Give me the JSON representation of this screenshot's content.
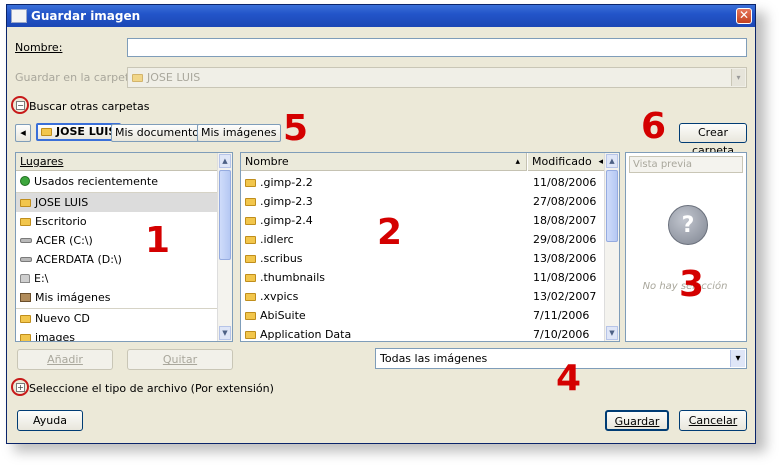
{
  "window": {
    "title": "Guardar imagen",
    "close_glyph": "✕"
  },
  "name_field": {
    "label": "Nombre:",
    "value": ""
  },
  "save_in": {
    "label": "Guardar en la carpeta:",
    "value": "JOSE LUIS"
  },
  "browse_toggle": {
    "label": "Buscar otras carpetas",
    "glyph": "−"
  },
  "path_bar": {
    "back_glyph": "◂",
    "buttons": [
      {
        "label": "JOSE LUIS"
      },
      {
        "label": "Mis documentos"
      },
      {
        "label": "Mis imágenes"
      }
    ],
    "create_folder": "Crear carpeta"
  },
  "places": {
    "header": "Lugares",
    "items": [
      {
        "label": "Usados recientemente",
        "icon": "recent-icon"
      },
      {
        "label": "JOSE LUIS",
        "icon": "folder-icon"
      },
      {
        "label": "Escritorio",
        "icon": "folder-icon"
      },
      {
        "label": "ACER (C:\\)",
        "icon": "drive-icon"
      },
      {
        "label": "ACERDATA (D:\\)",
        "icon": "drive-icon"
      },
      {
        "label": "E:\\",
        "icon": "drive-icon"
      },
      {
        "label": "Mis imágenes",
        "icon": "pictures-icon"
      },
      {
        "label": "Nuevo CD",
        "icon": "folder-icon"
      },
      {
        "label": "images",
        "icon": "folder-icon"
      }
    ],
    "add_button": "Añadir",
    "remove_button": "Quitar"
  },
  "files": {
    "col_name": "Nombre",
    "col_modified": "Modificado",
    "sort_glyph": "▴",
    "col_glyph": "◂",
    "rows": [
      {
        "name": ".gimp-2.2",
        "date": "11/08/2006"
      },
      {
        "name": ".gimp-2.3",
        "date": "27/08/2006"
      },
      {
        "name": ".gimp-2.4",
        "date": "18/08/2007"
      },
      {
        "name": ".idlerc",
        "date": "29/08/2006"
      },
      {
        "name": ".scribus",
        "date": "13/08/2006"
      },
      {
        "name": ".thumbnails",
        "date": "11/08/2006"
      },
      {
        "name": ".xvpics",
        "date": "13/02/2007"
      },
      {
        "name": "AbiSuite",
        "date": "7/11/2006"
      },
      {
        "name": "Application Data",
        "date": "7/10/2006"
      }
    ]
  },
  "preview": {
    "header": "Vista previa",
    "no_selection": "No hay selección",
    "icon_glyph": "?"
  },
  "filter": {
    "value": "Todas las imágenes",
    "arrow": "▾"
  },
  "file_type_toggle": {
    "label": "Seleccione el tipo de archivo (Por extensión)",
    "glyph": "+"
  },
  "buttons": {
    "help": "Ayuda",
    "save": "Guardar",
    "cancel": "Cancelar"
  },
  "annotations": [
    "1",
    "2",
    "3",
    "4",
    "5",
    "6"
  ],
  "colors": {
    "title_bar": "#2355c9",
    "annotation": "#d40000",
    "dialog_bg": "#ece9d8"
  }
}
